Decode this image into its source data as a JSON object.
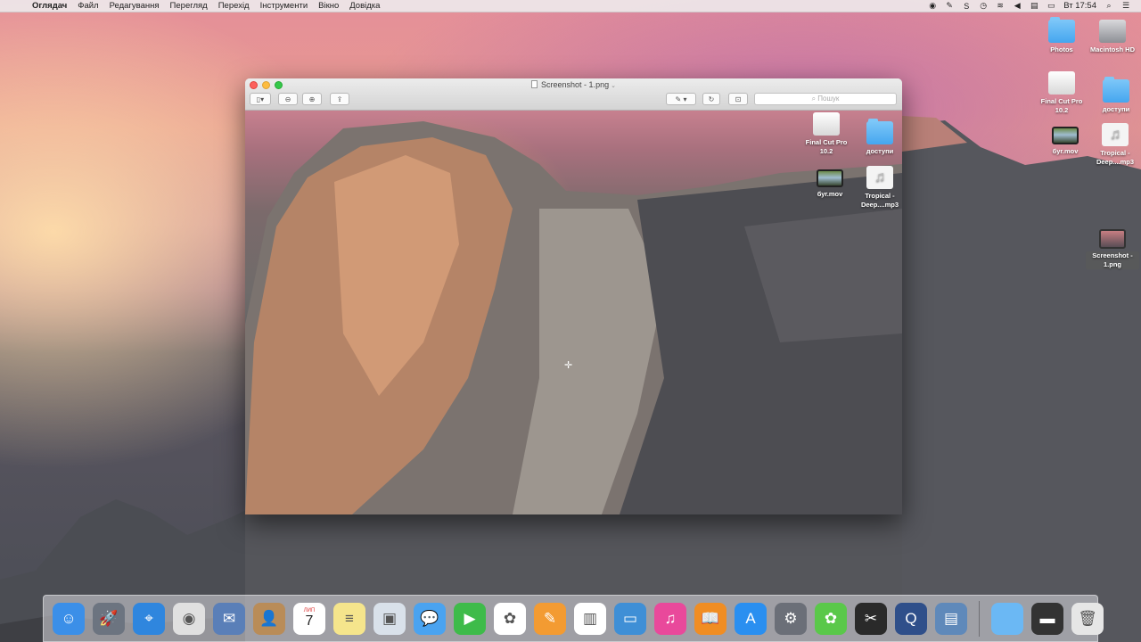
{
  "menubar": {
    "app_name": "Оглядач",
    "items": [
      "Файл",
      "Редагування",
      "Перегляд",
      "Перехід",
      "Інструменти",
      "Вікно",
      "Довідка"
    ],
    "clock": "Вт 17:54"
  },
  "desktop": {
    "right_icons": [
      {
        "label": "Photos",
        "kind": "folder"
      },
      {
        "label": "Macintosh HD",
        "kind": "drive"
      },
      {
        "label": "Final Cut Pro 10.2",
        "kind": "drive-white"
      },
      {
        "label": "доступи",
        "kind": "folder"
      },
      {
        "label": "бyr.mov",
        "kind": "movie"
      },
      {
        "label": "Tropical - Deep....mp3",
        "kind": "audio"
      },
      {
        "label": "Screenshot - 1.png",
        "kind": "shot"
      }
    ]
  },
  "window": {
    "title": "Screenshot - 1.png",
    "search_placeholder": "Пошук",
    "overlay_icons": [
      {
        "label": "Final Cut Pro 10.2"
      },
      {
        "label": "доступи"
      },
      {
        "label": "буг.mov"
      },
      {
        "label": "Tropical - Deep....mp3"
      }
    ]
  },
  "dock": {
    "calendar_month": "ЛИП",
    "calendar_day": "7",
    "apps": [
      {
        "name": "finder-icon",
        "color": "#3b8fe8",
        "glyph": "☺"
      },
      {
        "name": "launchpad-icon",
        "color": "#6c7480",
        "glyph": "🚀"
      },
      {
        "name": "safari-icon",
        "color": "#2f86de",
        "glyph": "⌖"
      },
      {
        "name": "chrome-icon",
        "color": "#e0e0e0",
        "glyph": "◉"
      },
      {
        "name": "mail-icon",
        "color": "#5a7fb8",
        "glyph": "✉"
      },
      {
        "name": "contacts-icon",
        "color": "#b98c58",
        "glyph": "👤"
      },
      {
        "name": "calendar-icon",
        "color": "#ffffff",
        "glyph": ""
      },
      {
        "name": "notes-icon",
        "color": "#f5e58c",
        "glyph": "≡"
      },
      {
        "name": "preview-icon",
        "color": "#d9e1ea",
        "glyph": "▣"
      },
      {
        "name": "messages-icon",
        "color": "#4aa3f0",
        "glyph": "💬"
      },
      {
        "name": "facetime-icon",
        "color": "#3ebb4a",
        "glyph": "▶"
      },
      {
        "name": "photos-icon",
        "color": "#ffffff",
        "glyph": "✿"
      },
      {
        "name": "pages-icon",
        "color": "#f39b32",
        "glyph": "✎"
      },
      {
        "name": "numbers-icon",
        "color": "#ffffff",
        "glyph": "▥"
      },
      {
        "name": "keynote-icon",
        "color": "#3f8fd6",
        "glyph": "▭"
      },
      {
        "name": "itunes-icon",
        "color": "#e9499b",
        "glyph": "♫"
      },
      {
        "name": "ibooks-icon",
        "color": "#f08d23",
        "glyph": "📖"
      },
      {
        "name": "appstore-icon",
        "color": "#2a8ff0",
        "glyph": "A"
      },
      {
        "name": "system-preferences-icon",
        "color": "#6b6f78",
        "glyph": "⚙"
      },
      {
        "name": "icq-icon",
        "color": "#5ac84a",
        "glyph": "✿"
      },
      {
        "name": "final-cut-icon",
        "color": "#2a2a2a",
        "glyph": "✂"
      },
      {
        "name": "quicktime-icon",
        "color": "#2f4f8a",
        "glyph": "Q"
      },
      {
        "name": "image-capture-icon",
        "color": "#5f89ba",
        "glyph": "▤"
      }
    ],
    "right_items": [
      {
        "name": "downloads-folder-icon",
        "color": "#6bb8f4",
        "glyph": ""
      },
      {
        "name": "stack-icon",
        "color": "#333333",
        "glyph": "▬"
      },
      {
        "name": "trash-icon",
        "color": "#e6e6e6",
        "glyph": "🗑"
      }
    ]
  }
}
